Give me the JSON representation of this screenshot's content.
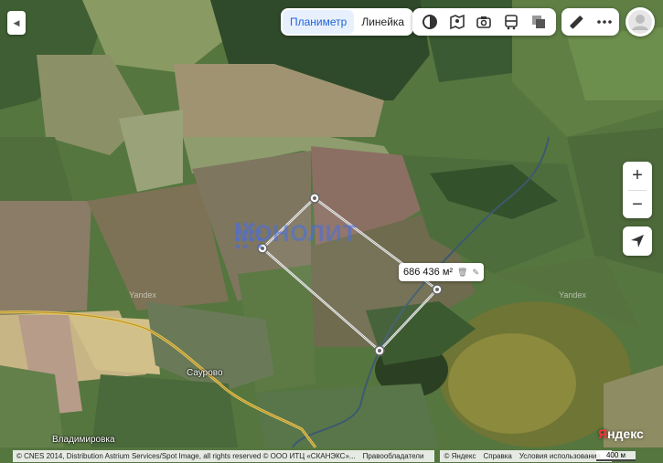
{
  "toolbar": {
    "tabs": [
      {
        "label": "Планиметр",
        "active": true
      },
      {
        "label": "Линейка",
        "active": false
      }
    ],
    "layer_icons": [
      "layers-icon",
      "panorama-icon",
      "camera-icon",
      "transport-icon",
      "stack-icon"
    ],
    "tool_icons": [
      "ruler-icon",
      "more-icon"
    ]
  },
  "measurement": {
    "area": "686 436 м²"
  },
  "map_labels": {
    "village": "Саурово",
    "village2": "Владимировка",
    "watermark": "Yandex",
    "brand_watermark": "МОНОЛИТ"
  },
  "zoom": {
    "in": "+",
    "out": "−"
  },
  "logo": {
    "first": "Я",
    "rest": "ндекс"
  },
  "footer": {
    "copyright": "© CNES 2014, Distribution Astrium Services/Spot Image, all rights reserved © ООО ИТЦ «СКАНЭКС»...",
    "rights_holders": "Правообладатели",
    "yandex": "© Яндекс",
    "help": "Справка",
    "terms": "Условия использования",
    "scale": "400 м"
  }
}
